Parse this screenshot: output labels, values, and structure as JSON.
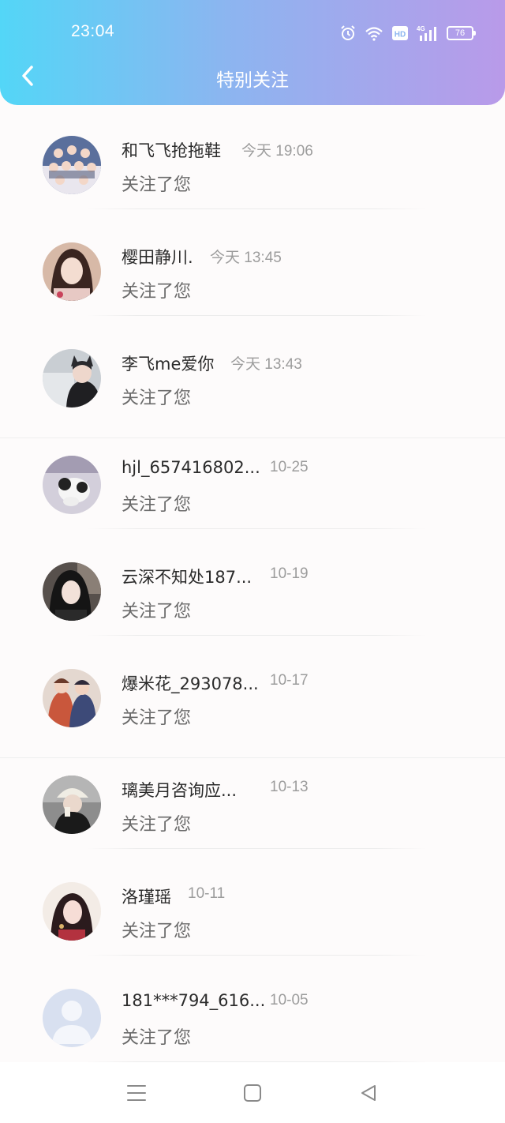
{
  "status_bar": {
    "time": "23:04",
    "battery": "76",
    "network": "4G",
    "hd": "HD"
  },
  "header": {
    "title": "特别关注"
  },
  "items": [
    {
      "name": "和飞飞抢拖鞋",
      "time": "今天 19:06",
      "action": "关注了您"
    },
    {
      "name": "樱田静川.",
      "time": "今天 13:45",
      "action": "关注了您"
    },
    {
      "name": "李飞me爱你",
      "time": "今天 13:43",
      "action": "关注了您"
    },
    {
      "name": "hjl_657416802...",
      "time": "10-25",
      "action": "关注了您"
    },
    {
      "name": "云深不知处187...",
      "time": "10-19",
      "action": "关注了您"
    },
    {
      "name": "爆米花_293078...",
      "time": "10-17",
      "action": "关注了您"
    },
    {
      "name": "璃美月咨询应...",
      "time": "10-13",
      "action": "关注了您"
    },
    {
      "name": "洛瑾瑶",
      "time": "10-11",
      "action": "关注了您"
    },
    {
      "name": "181***794_616...",
      "time": "10-05",
      "action": "关注了您"
    }
  ],
  "nav": {
    "menu_icon": "menu-icon",
    "home_icon": "square-home-icon",
    "back_icon": "triangle-back-icon"
  }
}
